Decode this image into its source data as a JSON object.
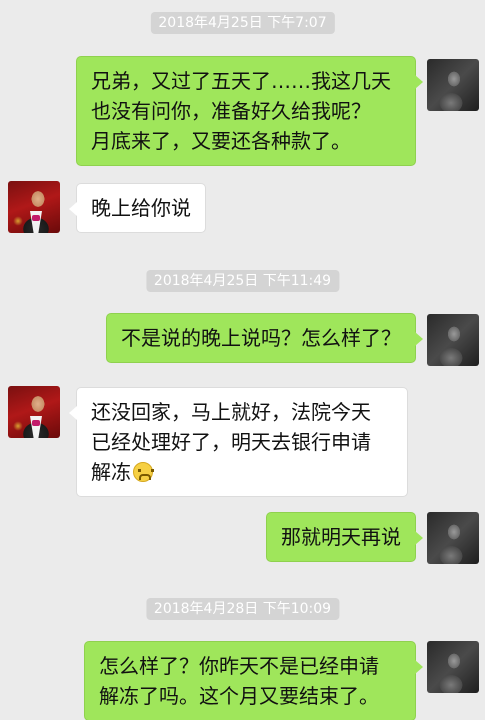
{
  "chat": {
    "timestamps": [
      "2018年4月25日  下午7:07",
      "2018年4月25日  下午11:49",
      "2018年4月28日  下午10:09"
    ],
    "messages": [
      {
        "from": "me",
        "lines": [
          "兄弟，又过了五天了……我这几天",
          "也没有问你，准备好久给我呢？",
          "月底来了，又要还各种款了。"
        ]
      },
      {
        "from": "friend",
        "lines": [
          "晚上给你说"
        ]
      },
      {
        "from": "me",
        "lines": [
          "不是说的晚上说吗？怎么样了？"
        ]
      },
      {
        "from": "friend",
        "lines": [
          "还没回家，马上就好，法院今天",
          "已经处理好了，明天去银行申请",
          "解冻"
        ],
        "emoji": "grimace-emoji"
      },
      {
        "from": "me",
        "lines": [
          "那就明天再说"
        ]
      },
      {
        "from": "me",
        "lines": [
          "怎么样了？你昨天不是已经申请",
          "解冻了吗。这个月又要结束了。"
        ]
      }
    ]
  },
  "colors": {
    "sent_bubble": "#9fe65b",
    "received_bubble": "#ffffff",
    "background": "#ebebeb",
    "timestamp_bg": "#d4d4d4"
  }
}
